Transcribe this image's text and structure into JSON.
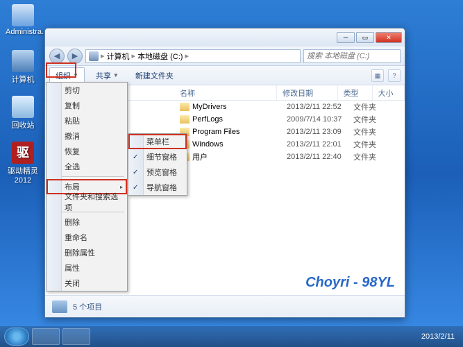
{
  "desktop": {
    "admin": "Administra...",
    "computer": "计算机",
    "recycle": "回收站",
    "driver_label": "驱动精灵\n2012",
    "driver_glyph": "驱"
  },
  "window": {
    "nav_back": "◀",
    "nav_fwd": "▶",
    "breadcrumb": {
      "root": "计算机",
      "drive": "本地磁盘 (C:)"
    },
    "search_placeholder": "搜索 本地磁盘 (C:)",
    "toolbar": {
      "organize": "组织",
      "share": "共享",
      "newfolder": "新建文件夹"
    },
    "columns": {
      "name": "名称",
      "date": "修改日期",
      "type": "类型",
      "size": "大小"
    },
    "files": [
      {
        "name": "MyDrivers",
        "date": "2013/2/11 22:52",
        "type": "文件夹"
      },
      {
        "name": "PerfLogs",
        "date": "2009/7/14 10:37",
        "type": "文件夹"
      },
      {
        "name": "Program Files",
        "date": "2013/2/11 23:09",
        "type": "文件夹"
      },
      {
        "name": "Windows",
        "date": "2013/2/11 22:01",
        "type": "文件夹"
      },
      {
        "name": "用户",
        "date": "2013/2/11 22:40",
        "type": "文件夹"
      }
    ],
    "status": "5 个项目",
    "watermark": "Choyri - 98YL"
  },
  "organize_menu": {
    "cut": "剪切",
    "copy": "复制",
    "paste": "粘贴",
    "undo": "撤消",
    "redo": "恢复",
    "selectall": "全选",
    "layout": "布局",
    "folder_opts": "文件夹和搜索选项",
    "delete": "删除",
    "rename": "重命名",
    "remove_props": "删除属性",
    "properties": "属性",
    "close": "关闭"
  },
  "layout_submenu": {
    "menubar": "菜单栏",
    "details": "细节窗格",
    "preview": "预览窗格",
    "nav": "导航窗格"
  },
  "taskbar": {
    "date": "2013/2/11"
  }
}
